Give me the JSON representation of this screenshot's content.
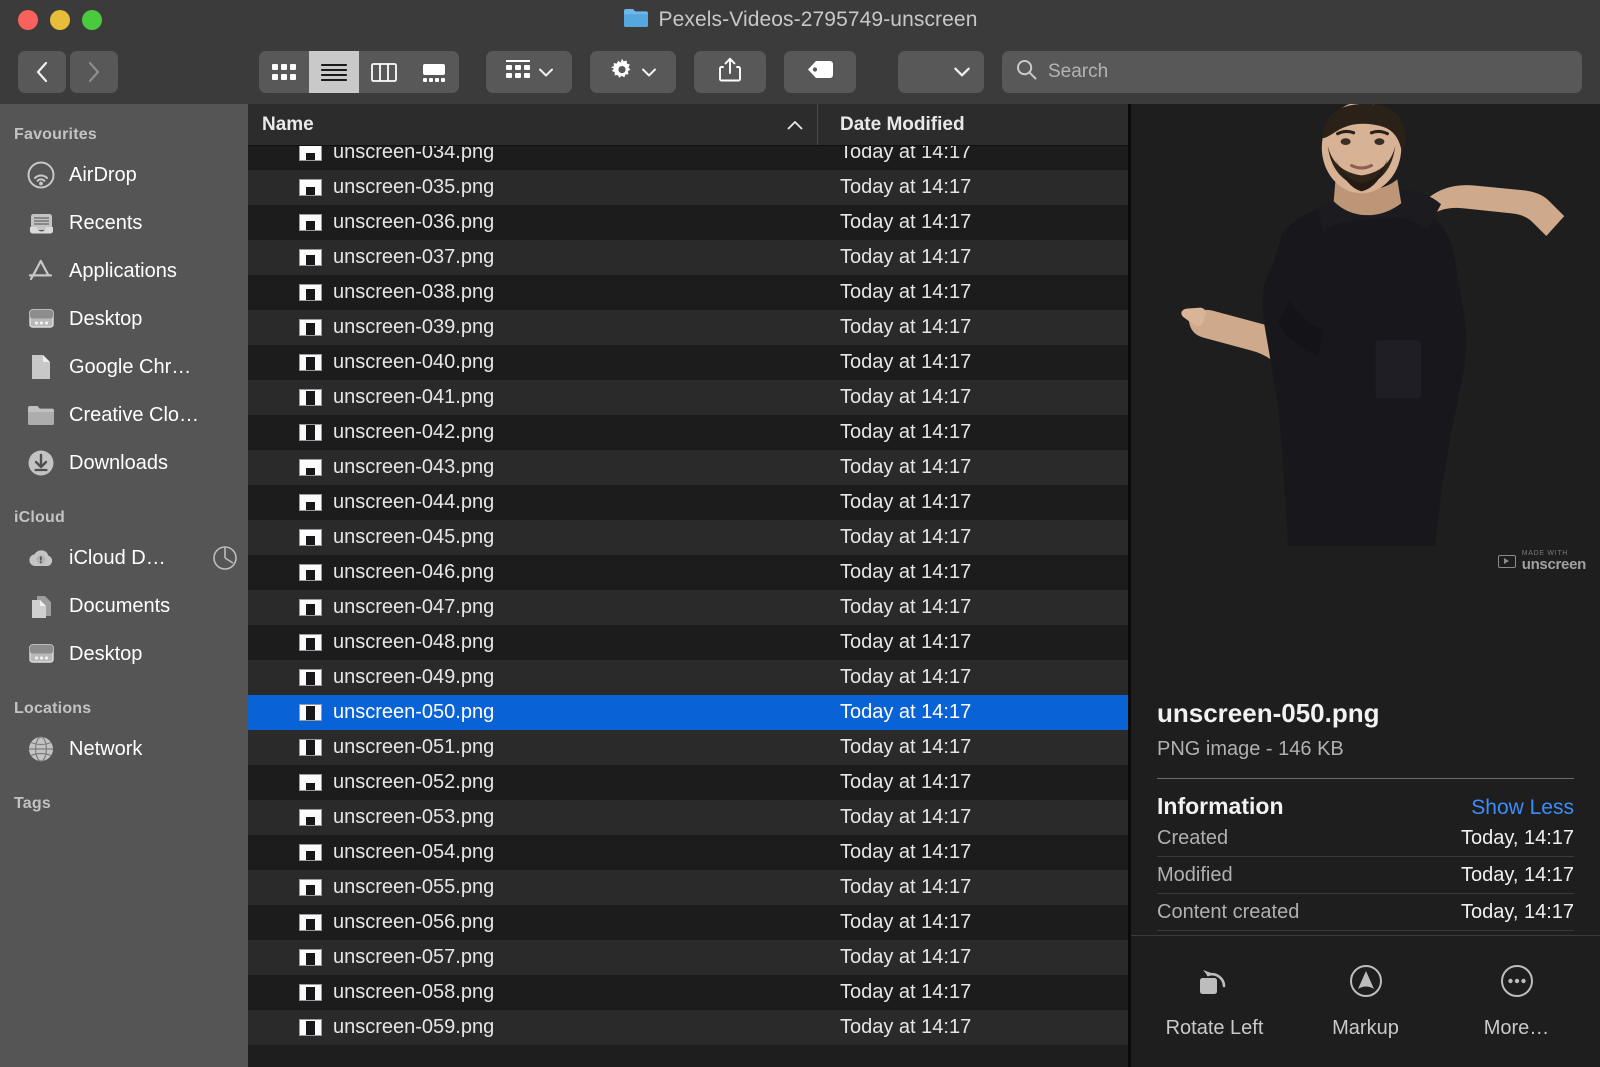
{
  "window": {
    "title": "Pexels-Videos-2795749-unscreen",
    "folder_icon": "folder-icon",
    "traffic_lights": [
      "close-button",
      "minimize-button",
      "zoom-button"
    ]
  },
  "toolbar": {
    "back_label": "‹",
    "forward_label": "›",
    "view_modes": [
      {
        "name": "icon-view",
        "label": "Icon View",
        "active": false
      },
      {
        "name": "list-view",
        "label": "List View",
        "active": true
      },
      {
        "name": "column-view",
        "label": "Column View",
        "active": false
      },
      {
        "name": "gallery-view",
        "label": "Gallery View",
        "active": false
      }
    ],
    "arrange_label": "Group items",
    "actions_label": "Action",
    "share_label": "Share",
    "tags_label": "Edit Tags",
    "plugin_label": "",
    "caret": "⌄"
  },
  "search": {
    "placeholder": "Search",
    "value": "",
    "icon": "search-icon"
  },
  "sidebar": {
    "sections": [
      {
        "header": "Favourites",
        "items": [
          {
            "label": "AirDrop",
            "icon": "airdrop-icon"
          },
          {
            "label": "Recents",
            "icon": "recents-icon"
          },
          {
            "label": "Applications",
            "icon": "applications-icon"
          },
          {
            "label": "Desktop",
            "icon": "desktop-icon"
          },
          {
            "label": "Google Chr…",
            "icon": "document-icon"
          },
          {
            "label": "Creative Clo…",
            "icon": "folder-icon"
          },
          {
            "label": "Downloads",
            "icon": "downloads-icon"
          }
        ]
      },
      {
        "header": "iCloud",
        "items": [
          {
            "label": "iCloud D…",
            "icon": "icloud-alert-icon",
            "trailing": "sync-progress-icon"
          },
          {
            "label": "Documents",
            "icon": "documents-icon"
          },
          {
            "label": "Desktop",
            "icon": "desktop-icon"
          }
        ]
      },
      {
        "header": "Locations",
        "items": [
          {
            "label": "Network",
            "icon": "network-globe-icon"
          }
        ]
      },
      {
        "header": "Tags",
        "items": []
      }
    ]
  },
  "filelist": {
    "columns": [
      {
        "key": "name",
        "label": "Name",
        "sorted": true,
        "sort_arrow": "⌃"
      },
      {
        "key": "date",
        "label": "Date Modified",
        "sorted": false
      }
    ],
    "partial_top_row": {
      "name": "",
      "date": ""
    },
    "rows": [
      {
        "name": "unscreen-034.png",
        "date": "Today at 14:17",
        "selected": false
      },
      {
        "name": "unscreen-035.png",
        "date": "Today at 14:17",
        "selected": false
      },
      {
        "name": "unscreen-036.png",
        "date": "Today at 14:17",
        "selected": false
      },
      {
        "name": "unscreen-037.png",
        "date": "Today at 14:17",
        "selected": false
      },
      {
        "name": "unscreen-038.png",
        "date": "Today at 14:17",
        "selected": false
      },
      {
        "name": "unscreen-039.png",
        "date": "Today at 14:17",
        "selected": false
      },
      {
        "name": "unscreen-040.png",
        "date": "Today at 14:17",
        "selected": false
      },
      {
        "name": "unscreen-041.png",
        "date": "Today at 14:17",
        "selected": false
      },
      {
        "name": "unscreen-042.png",
        "date": "Today at 14:17",
        "selected": false
      },
      {
        "name": "unscreen-043.png",
        "date": "Today at 14:17",
        "selected": false
      },
      {
        "name": "unscreen-044.png",
        "date": "Today at 14:17",
        "selected": false
      },
      {
        "name": "unscreen-045.png",
        "date": "Today at 14:17",
        "selected": false
      },
      {
        "name": "unscreen-046.png",
        "date": "Today at 14:17",
        "selected": false
      },
      {
        "name": "unscreen-047.png",
        "date": "Today at 14:17",
        "selected": false
      },
      {
        "name": "unscreen-048.png",
        "date": "Today at 14:17",
        "selected": false
      },
      {
        "name": "unscreen-049.png",
        "date": "Today at 14:17",
        "selected": false
      },
      {
        "name": "unscreen-050.png",
        "date": "Today at 14:17",
        "selected": true
      },
      {
        "name": "unscreen-051.png",
        "date": "Today at 14:17",
        "selected": false
      },
      {
        "name": "unscreen-052.png",
        "date": "Today at 14:17",
        "selected": false
      },
      {
        "name": "unscreen-053.png",
        "date": "Today at 14:17",
        "selected": false
      },
      {
        "name": "unscreen-054.png",
        "date": "Today at 14:17",
        "selected": false
      },
      {
        "name": "unscreen-055.png",
        "date": "Today at 14:17",
        "selected": false
      },
      {
        "name": "unscreen-056.png",
        "date": "Today at 14:17",
        "selected": false
      },
      {
        "name": "unscreen-057.png",
        "date": "Today at 14:17",
        "selected": false
      },
      {
        "name": "unscreen-058.png",
        "date": "Today at 14:17",
        "selected": false
      },
      {
        "name": "unscreen-059.png",
        "date": "Today at 14:17",
        "selected": false
      }
    ]
  },
  "preview": {
    "watermark": {
      "made_with": "MADE WITH",
      "brand": "unscreen"
    },
    "filename": "unscreen-050.png",
    "kind": "PNG image - 146 KB",
    "info_title": "Information",
    "show_less": "Show Less",
    "metadata": [
      {
        "key": "Created",
        "value": "Today, 14:17"
      },
      {
        "key": "Modified",
        "value": "Today, 14:17"
      },
      {
        "key": "Content created",
        "value": "Today, 14:17"
      }
    ],
    "actions": [
      {
        "label": "Rotate Left",
        "icon": "rotate-left-icon"
      },
      {
        "label": "Markup",
        "icon": "markup-icon"
      },
      {
        "label": "More…",
        "icon": "more-ellipsis-icon"
      }
    ]
  },
  "colors": {
    "selection_blue": "#0a63d6",
    "link_blue": "#3b8dfb",
    "sidebar_bg": "#555555",
    "toolbar_bg": "#3b3b3b",
    "list_bg": "#1e1e1e"
  }
}
